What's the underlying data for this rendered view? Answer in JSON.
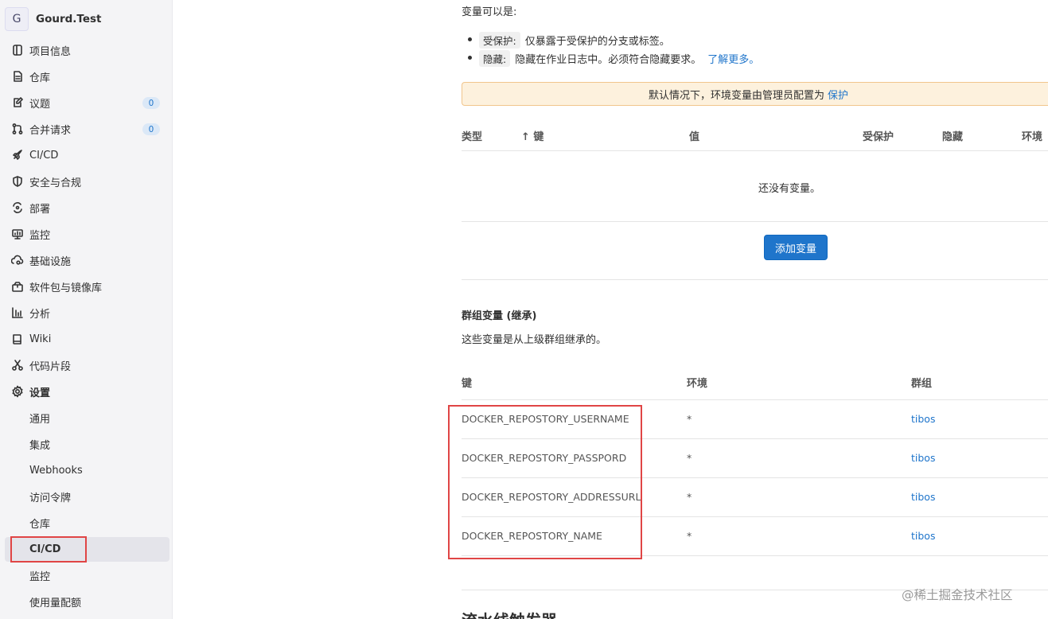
{
  "project": {
    "avatar_letter": "G",
    "name": "Gourd.Test"
  },
  "sidebar": {
    "items": [
      {
        "label": "项目信息",
        "icon": "project-info-icon"
      },
      {
        "label": "仓库",
        "icon": "document-icon"
      },
      {
        "label": "议题",
        "icon": "issues-icon",
        "badge": "0"
      },
      {
        "label": "合并请求",
        "icon": "merge-request-icon",
        "badge": "0"
      },
      {
        "label": "CI/CD",
        "icon": "rocket-icon"
      },
      {
        "label": "安全与合规",
        "icon": "shield-icon"
      },
      {
        "label": "部署",
        "icon": "deployments-icon"
      },
      {
        "label": "监控",
        "icon": "monitor-icon"
      },
      {
        "label": "基础设施",
        "icon": "cloud-gear-icon"
      },
      {
        "label": "软件包与镜像库",
        "icon": "package-icon"
      },
      {
        "label": "分析",
        "icon": "chart-icon"
      },
      {
        "label": "Wiki",
        "icon": "book-icon"
      },
      {
        "label": "代码片段",
        "icon": "scissors-icon"
      },
      {
        "label": "设置",
        "icon": "gear-icon"
      }
    ],
    "settings_subitems": [
      {
        "label": "通用"
      },
      {
        "label": "集成"
      },
      {
        "label": "Webhooks"
      },
      {
        "label": "访问令牌"
      },
      {
        "label": "仓库"
      },
      {
        "label": "CI/CD",
        "active": true
      },
      {
        "label": "监控"
      },
      {
        "label": "使用量配额"
      }
    ]
  },
  "main": {
    "intro": "变量可以是:",
    "bullets": [
      {
        "code": "受保护:",
        "text": "仅暴露于受保护的分支或标签。"
      },
      {
        "code": "隐藏:",
        "text": "隐藏在作业日志中。必须符合隐藏要求。",
        "link": "了解更多。"
      }
    ],
    "alert": {
      "text": "默认情况下，环境变量由管理员配置为",
      "link": "保护"
    },
    "variables_table": {
      "headers": {
        "type": "类型",
        "key": "↑ 键",
        "value": "值",
        "protected": "受保护",
        "masked": "隐藏",
        "environment": "环境"
      },
      "empty": "还没有变量。"
    },
    "add_button": "添加变量",
    "group_section": {
      "title": "群组变量 (继承)",
      "description": "这些变量是从上级群组继承的。",
      "headers": {
        "key": "键",
        "environment": "环境",
        "group": "群组"
      },
      "rows": [
        {
          "key": "DOCKER_REPOSTORY_USERNAME",
          "environment": "*",
          "group": "tibos"
        },
        {
          "key": "DOCKER_REPOSTORY_PASSPORD",
          "environment": "*",
          "group": "tibos"
        },
        {
          "key": "DOCKER_REPOSTORY_ADDRESSURL",
          "environment": "*",
          "group": "tibos"
        },
        {
          "key": "DOCKER_REPOSTORY_NAME",
          "environment": "*",
          "group": "tibos"
        }
      ]
    },
    "next_section_title": "流水线触发器"
  },
  "watermark": "@稀土掘金技术社区",
  "colors": {
    "accent": "#1f75cb",
    "highlight": "#e04545",
    "alert_bg": "#fdf1dd"
  }
}
